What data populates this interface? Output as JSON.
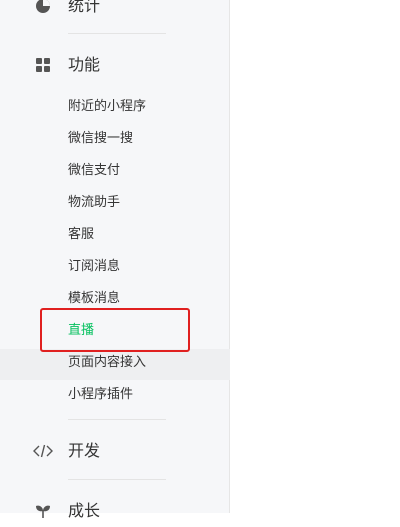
{
  "sidebar": {
    "stats_label": "统计",
    "features_label": "功能",
    "features_items": [
      {
        "label": "附近的小程序"
      },
      {
        "label": "微信搜一搜"
      },
      {
        "label": "微信支付"
      },
      {
        "label": "物流助手"
      },
      {
        "label": "客服"
      },
      {
        "label": "订阅消息"
      },
      {
        "label": "模板消息"
      },
      {
        "label": "直播"
      },
      {
        "label": "页面内容接入"
      },
      {
        "label": "小程序插件"
      }
    ],
    "dev_label": "开发",
    "growth_label": "成长"
  },
  "colors": {
    "active": "#07c160",
    "highlight": "#e02020",
    "text": "#353535",
    "icon": "#555555"
  },
  "icons": {
    "stats": "pie-chart-icon",
    "features": "grid-icon",
    "dev": "code-icon",
    "growth": "sprout-icon"
  },
  "state": {
    "active_item": "直播",
    "hovered_item": "页面内容接入"
  }
}
